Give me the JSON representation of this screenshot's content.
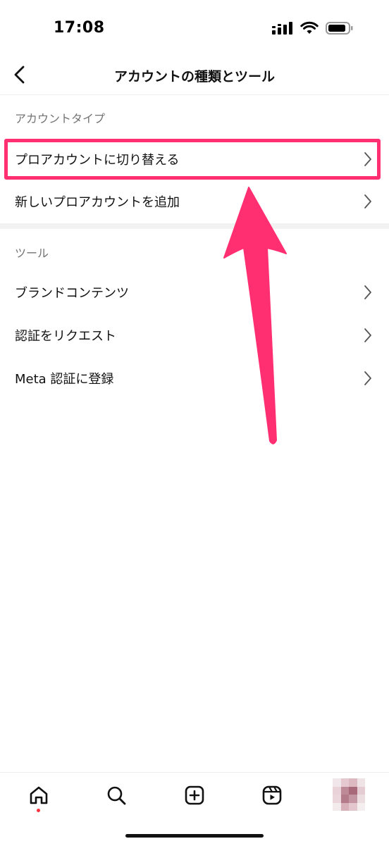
{
  "status_bar": {
    "time": "17:08"
  },
  "header": {
    "title": "アカウントの種類とツール"
  },
  "sections": [
    {
      "title": "アカウントタイプ",
      "items": [
        {
          "label": "プロアカウントに切り替える"
        },
        {
          "label": "新しいプロアカウントを追加"
        }
      ]
    },
    {
      "title": "ツール",
      "items": [
        {
          "label": "ブランドコンテンツ"
        },
        {
          "label": "認証をリクエスト"
        },
        {
          "label": "Meta 認証に登録"
        }
      ]
    }
  ],
  "annotation": {
    "highlight_color": "#ff2f72",
    "highlighted_item": "プロアカウントに切り替える"
  },
  "colors": {
    "text": "#111111",
    "muted": "#737373",
    "notification": "#ff3040"
  },
  "tab_bar": {
    "items": [
      {
        "icon": "home-icon",
        "has_notification": true
      },
      {
        "icon": "search-icon"
      },
      {
        "icon": "create-icon"
      },
      {
        "icon": "reels-icon"
      },
      {
        "icon": "profile-avatar"
      }
    ]
  }
}
